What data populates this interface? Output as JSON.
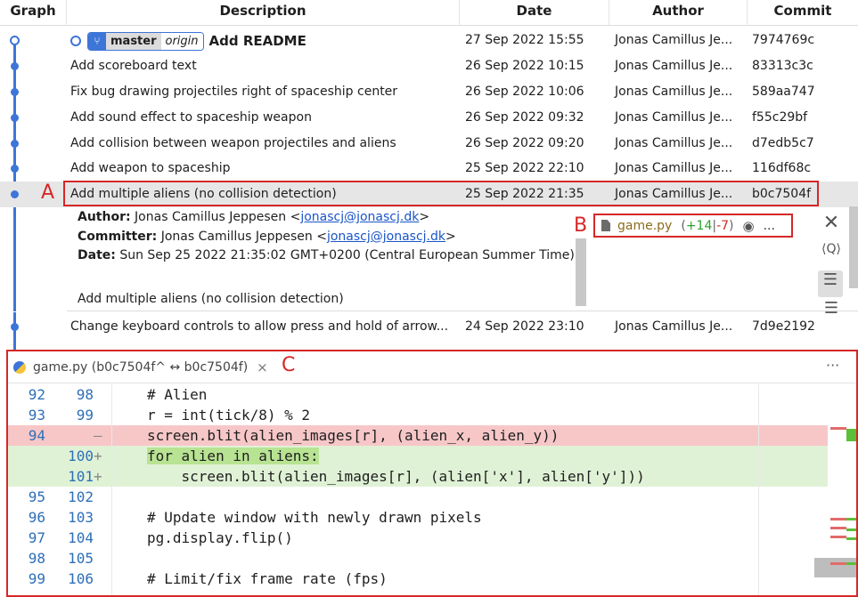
{
  "columns": {
    "graph": "Graph",
    "description": "Description",
    "date": "Date",
    "author": "Author",
    "commit": "Commit"
  },
  "refs": {
    "branch": "master",
    "remote": "origin",
    "branch_icon": "git-branch-icon"
  },
  "commits": [
    {
      "description": "Add README",
      "date": "27 Sep 2022 15:55",
      "author": "Jonas Camillus Je...",
      "hash": "7974769c"
    },
    {
      "description": "Add scoreboard text",
      "date": "26 Sep 2022 10:15",
      "author": "Jonas Camillus Je...",
      "hash": "83313c3c"
    },
    {
      "description": "Fix bug drawing projectiles right of spaceship center",
      "date": "26 Sep 2022 10:06",
      "author": "Jonas Camillus Je...",
      "hash": "589aa747"
    },
    {
      "description": "Add sound effect to spaceship weapon",
      "date": "26 Sep 2022 09:32",
      "author": "Jonas Camillus Je...",
      "hash": "f55c29bf"
    },
    {
      "description": "Add collision between weapon projectiles and aliens",
      "date": "26 Sep 2022 09:20",
      "author": "Jonas Camillus Je...",
      "hash": "d7edb5c7"
    },
    {
      "description": "Add weapon to spaceship",
      "date": "25 Sep 2022 22:10",
      "author": "Jonas Camillus Je...",
      "hash": "116df68c"
    },
    {
      "description": "Add multiple aliens (no collision detection)",
      "date": "25 Sep 2022 21:35",
      "author": "Jonas Camillus Je...",
      "hash": "b0c7504f"
    },
    {
      "description": "Change keyboard controls to allow press and hold of arrow...",
      "date": "24 Sep 2022 23:10",
      "author": "Jonas Camillus Je...",
      "hash": "7d9e2192"
    }
  ],
  "annotations": {
    "a": "A",
    "b": "B",
    "c": "C"
  },
  "detail": {
    "author_label": "Author:",
    "author_name": "Jonas Camillus Jeppesen <",
    "author_email": "jonascj@jonascj.dk",
    "author_close": ">",
    "committer_label": "Committer:",
    "committer_name": "Jonas Camillus Jeppesen <",
    "committer_email": "jonascj@jonascj.dk",
    "committer_close": ">",
    "date_label": "Date:",
    "date_value": "Sun Sep 25 2022 21:35:02 GMT+0200 (Central European Summer Time)",
    "message": "Add multiple aliens (no collision detection)"
  },
  "changed_file": {
    "name": "game.py",
    "additions": "+14",
    "separator": "|",
    "deletions": "-7",
    "open_paren": "(",
    "close_paren": ")",
    "more": "..."
  },
  "diff": {
    "tab_title": "game.py (b0c7504f^ ↔ b0c7504f)",
    "tab_close": "×",
    "more": "···",
    "lines": [
      {
        "n1": "92",
        "n2": "98",
        "marker": "",
        "text": "# Alien",
        "kind": "ctx"
      },
      {
        "n1": "93",
        "n2": "99",
        "marker": "",
        "text": "r = int(tick/8) % 2",
        "kind": "ctx"
      },
      {
        "n1": "94",
        "n2": "",
        "marker": "—",
        "text": "screen.blit(alien_images[r], (alien_x, alien_y))",
        "kind": "del"
      },
      {
        "n1": "",
        "n2": "100",
        "marker": "+",
        "text": "for alien in aliens:",
        "kind": "add"
      },
      {
        "n1": "",
        "n2": "101",
        "marker": "+",
        "text": "    screen.blit(alien_images[r], (alien['x'], alien['y']))",
        "kind": "add"
      },
      {
        "n1": "95",
        "n2": "102",
        "marker": "",
        "text": "",
        "kind": "ctx"
      },
      {
        "n1": "96",
        "n2": "103",
        "marker": "",
        "text": "# Update window with newly drawn pixels",
        "kind": "ctx"
      },
      {
        "n1": "97",
        "n2": "104",
        "marker": "",
        "text": "pg.display.flip()",
        "kind": "ctx"
      },
      {
        "n1": "98",
        "n2": "105",
        "marker": "",
        "text": "",
        "kind": "ctx"
      },
      {
        "n1": "99",
        "n2": "106",
        "marker": "",
        "text": "# Limit/fix frame rate (fps)",
        "kind": "ctx"
      }
    ]
  },
  "colors": {
    "accent": "#3d75d8",
    "annotation": "#d62728",
    "deleted_line": "#f7c7c8",
    "added_line": "#e0f2d6",
    "additions": "#2e9e2e",
    "deletions": "#d62728"
  }
}
